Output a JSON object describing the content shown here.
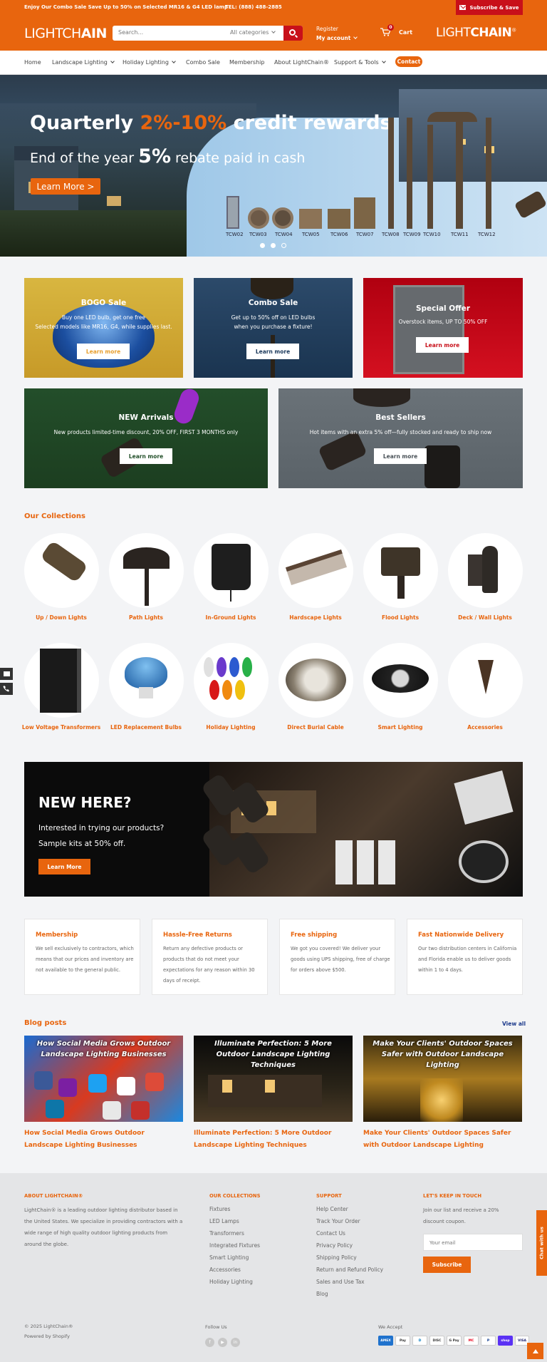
{
  "topbar": {
    "promo": "Enjoy Our Combo Sale Save Up to 50% on Selected MR16 & G4 LED lamp",
    "tel": "TEL: (888) 488-2885",
    "subscribe": "Subscribe & Save"
  },
  "header": {
    "logo_left_a": "LIGHTCH",
    "logo_left_b": "AIN",
    "search_placeholder": "Search...",
    "search_category": "All categories",
    "register": "Register",
    "my_account": "My account",
    "cart_count": "0",
    "cart": "Cart",
    "logo_right_a": "LIGHT",
    "logo_right_b": "CHAIN",
    "logo_right_reg": "®"
  },
  "nav": {
    "items": [
      "Home",
      "Landscape Lighting",
      "Holiday Lighting",
      "Combo Sale",
      "Membership",
      "About LightChain®",
      "Support & Tools"
    ],
    "contact": "Contact"
  },
  "hero": {
    "headline_a": "Quarterly ",
    "headline_b": "2%-10%",
    "headline_c": " credit rewards",
    "sub_a": "End of the year ",
    "sub_b": "5%",
    "sub_c": " rebate paid in cash",
    "cta": "Learn More >",
    "products": [
      "TCW02",
      "TCW03",
      "TCW04",
      "TCW05",
      "TCW06",
      "TCW07",
      "TCW08",
      "TCW09",
      "TCW10",
      "TCW11",
      "TCW12"
    ]
  },
  "promos": [
    {
      "title": "BOGO Sale",
      "desc1": "Buy one LED bulb, get one free",
      "desc2": "Selected models like MR16, G4, while supplies last.",
      "cta": "Learn more"
    },
    {
      "title": "Combo Sale",
      "desc1": "Get up to 50% off on LED bulbs",
      "desc2": "when you purchase a fixture!",
      "cta": "Learn more"
    },
    {
      "title": "Special Offer",
      "desc1": "Overstock items, UP TO 50% OFF",
      "desc2": "",
      "cta": "Learn more"
    },
    {
      "title": "NEW Arrivals",
      "desc1": "New products limited-time discount, 20% OFF, FIRST 3 MONTHS only",
      "desc2": "",
      "cta": "Learn more"
    },
    {
      "title": "Best Sellers",
      "desc1": "Hot items with an extra 5% off—fully stocked and ready to ship now",
      "desc2": "",
      "cta": "Learn more"
    }
  ],
  "collections": {
    "title": "Our Collections",
    "items": [
      "Up / Down Lights",
      "Path Lights",
      "In-Ground Lights",
      "Hardscape Lights",
      "Flood Lights",
      "Deck / Wall Lights",
      "Low Voltage Transformers",
      "LED Replacement Bulbs",
      "Holiday Lighting",
      "Direct Burial Cable",
      "Smart Lighting",
      "Accessories"
    ]
  },
  "newhere": {
    "title": "NEW HERE?",
    "line1": "Interested in trying our products?",
    "line2": "Sample kits at 50% off.",
    "cta": "Learn More"
  },
  "features": [
    {
      "title": "Membership",
      "desc": "We sell exclusively to contractors, which means that our prices and inventory are not available to the general public."
    },
    {
      "title": "Hassle-Free Returns",
      "desc": "Return any defective products or products that do not meet your expectations for any reason within 30 days of receipt."
    },
    {
      "title": "Free shipping",
      "desc": "We got you covered! We deliver your goods using UPS shipping, free of charge for orders above $500."
    },
    {
      "title": "Fast Nationwide Delivery",
      "desc": "Our two distribution centers in California and Florida enable us to deliver goods within 1 to 4 days."
    }
  ],
  "blog": {
    "title": "Blog posts",
    "view_all": "View all",
    "posts": [
      {
        "caption": "How Social Media Grows Outdoor Landscape Lighting Businesses",
        "title": "How Social Media Grows Outdoor Landscape Lighting Businesses"
      },
      {
        "caption": "Illuminate Perfection: 5 More Outdoor Landscape Lighting Techniques",
        "title": "Illuminate Perfection: 5 More Outdoor Landscape Lighting Techniques"
      },
      {
        "caption": "Make Your Clients' Outdoor Spaces Safer with Outdoor Landscape Lighting",
        "title": "Make Your Clients' Outdoor Spaces Safer with Outdoor Landscape Lighting"
      }
    ]
  },
  "footer": {
    "about_h": "ABOUT LIGHTCHAIN®",
    "about_p": "LightChain® is a leading outdoor lighting distributor based in the United States. We specialize in providing contractors with a wide range of high quality outdoor lighting products from around the globe.",
    "coll_h": "OUR COLLECTIONS",
    "coll_links": [
      "Fixtures",
      "LED Lamps",
      "Transformers",
      "Integrated Fixtures",
      "Smart Lighting",
      "Accessories",
      "Holiday Lighting"
    ],
    "support_h": "SUPPORT",
    "support_links": [
      "Help Center",
      "Track Your Order",
      "Contact Us",
      "Privacy Policy",
      "Shipping Policy",
      "Return and Refund Policy",
      "Sales and Use Tax",
      "Blog"
    ],
    "touch_h": "LET'S KEEP IN TOUCH",
    "touch_p": "Join our list and receive a 20% discount coupon.",
    "email_placeholder": "Your email",
    "subscribe": "Subscribe",
    "copyright": "© 2025 LightChain®",
    "powered": "Powered by Shopify",
    "follow": "Follow Us",
    "accept": "We Accept",
    "payments": [
      "AMEX",
      "Pay",
      "D",
      "DISC",
      "G Pay",
      "MC",
      "P",
      "shop",
      "VISA"
    ],
    "chat": "Chat with us"
  },
  "colors": {
    "brand": "#e8650e",
    "accent_red": "#c8101a"
  }
}
